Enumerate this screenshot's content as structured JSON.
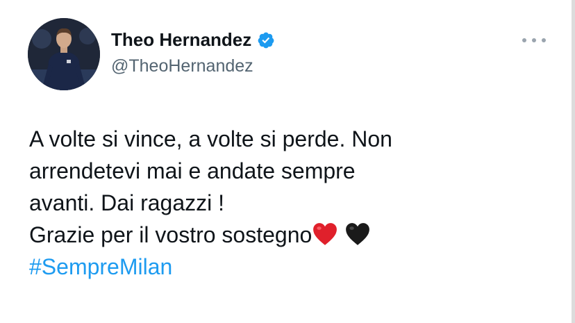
{
  "author": {
    "display_name": "Theo Hernandez",
    "handle": "@TheoHernandez",
    "verified": true,
    "avatar": "player-photo-avatar"
  },
  "tweet": {
    "lines": [
      "A volte si vince, a volte si perde. Non",
      "arrendetevi mai e andate sempre",
      "avanti. Dai ragazzi !",
      "Grazie per il vostro sostegno"
    ],
    "emojis": [
      "red-heart-icon",
      "black-heart-icon"
    ],
    "hashtag": "#SempreMilan"
  },
  "icons": {
    "more": "more-options-icon",
    "verified": "verified-badge-icon"
  },
  "colors": {
    "text_primary": "#0f1419",
    "text_secondary": "#536471",
    "link": "#1d9bf0",
    "verified": "#1d9bf0",
    "red_heart": "#e0202b",
    "black_heart": "#1a1a1a"
  }
}
